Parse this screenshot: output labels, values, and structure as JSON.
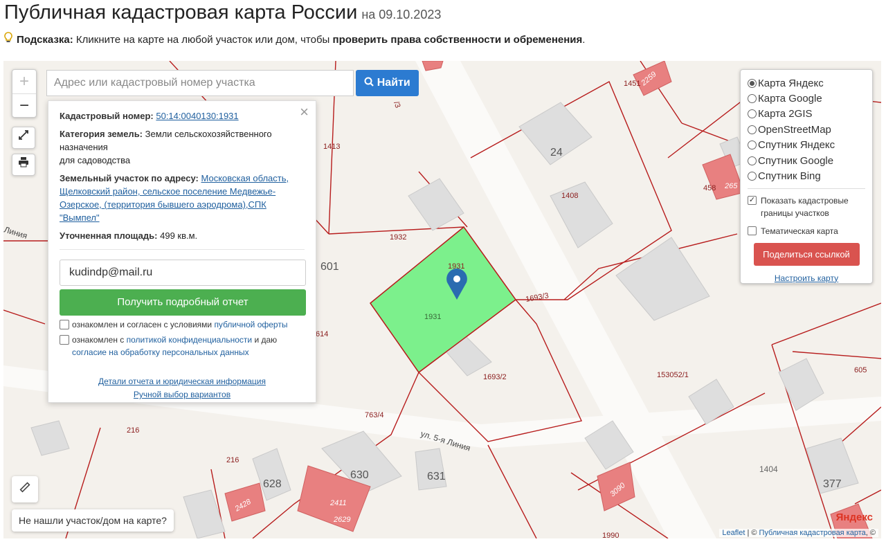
{
  "header": {
    "title": "Публичная кадастровая карта России",
    "date": "на 09.10.2023",
    "hint_label": "Подсказка:",
    "hint_text": " Кликните на карте на любой участок или дом, чтобы ",
    "hint_bold": "проверить права собственности и обременения",
    "hint_end": "."
  },
  "search": {
    "placeholder": "Адрес или кадастровый номер участка",
    "button_label": "Найти"
  },
  "zoom": {
    "in": "+",
    "out": "−"
  },
  "popup": {
    "cadastral_label": "Кадастровый номер:",
    "cadastral_number": "50:14:0040130:1931",
    "category_label": "Категория земель:",
    "category_value": "Земли сельскохозяйственного назначения",
    "category_use": "для садоводства",
    "address_label": "Земельный участок по адресу:",
    "address_value": "Московская область, Щелковский район, сельское поселение Медвежье-Озерское, (территория бывшего аэродрома),СПК \"Вымпел\"",
    "area_label": "Уточненная площадь:",
    "area_value": "499 кв.м.",
    "email_value": "kudindp@mail.ru",
    "report_button": "Получить подробный отчет",
    "consent1_text": "ознакомлен и согласен с условиями ",
    "consent1_link": "публичной оферты",
    "consent2_text": "ознакомлен с ",
    "consent2_link": "политикой конфиденциальности",
    "consent2_mid": " и даю ",
    "consent2_link2": "согласие на обработку персональных данных",
    "link_details": "Детали отчета и юридическая информация",
    "link_manual": "Ручной выбор вариантов"
  },
  "layers": {
    "options": [
      "Карта Яндекс",
      "Карта Google",
      "Карта 2GIS",
      "OpenStreetMap",
      "Спутник Яндекс",
      "Спутник Google",
      "Спутник Bing"
    ],
    "selected": "Карта Яндекс",
    "show_borders_label": "Показать кадастровые границы участков",
    "show_borders_checked": true,
    "thematic_label": "Тематическая карта",
    "thematic_checked": false,
    "share_button": "Поделиться ссылкой",
    "setup_link": "Настроить карту"
  },
  "map": {
    "labels": {
      "p1931": "1931",
      "p1931b": "1931",
      "p1932": "1932",
      "p1413": "1413",
      "p1408": "1408",
      "p1693_3": "1693/3",
      "p1693_2": "1693/2",
      "p153052_1": "153052/1",
      "p763_4": "763/4",
      "p216a": "216",
      "p216b": "216",
      "p628": "628",
      "p630": "630",
      "p631": "631",
      "p601": "601",
      "p24": "24",
      "p605": "605",
      "p1404": "1404",
      "p377": "377",
      "p1990": "1990",
      "p2411": "2411",
      "p2428": "2428",
      "p2629": "2629",
      "p3090": "3090",
      "p1451": "1451",
      "p2259": "2259",
      "p458": "458",
      "p265": "265",
      "p614": "614",
      "p3": "/3",
      "street": "ул. 5-я Линия",
      "street2": "Линия"
    },
    "not_found_label": "Не нашли участок/дом на карте?",
    "attribution_leaflet": "Leaflet",
    "attribution_sep": " | © ",
    "attribution_pkk": "Публичная кадастровая карта",
    "attribution_end": ", ©",
    "logo": "Яндекс"
  },
  "colors": {
    "selected_parcel": "#7cf08c",
    "parcel_border": "#b71c1c",
    "building": "#dedede",
    "pink_building": "#e88080",
    "primary": "#2c7bd1",
    "green_button": "#4caf50",
    "red_button": "#d9534f"
  }
}
